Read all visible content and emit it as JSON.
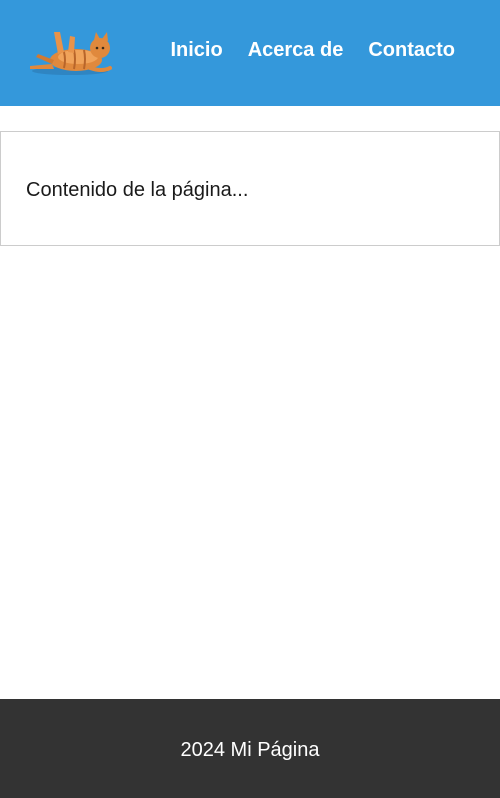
{
  "header": {
    "logo": {
      "icon": "cat-logo-icon"
    },
    "nav": {
      "items": [
        {
          "label": "Inicio"
        },
        {
          "label": "Acerca de"
        },
        {
          "label": "Contacto"
        }
      ]
    }
  },
  "main": {
    "content_text": "Contenido de la página..."
  },
  "footer": {
    "text": "2024 Mi Página"
  },
  "colors": {
    "header_bg": "#3498db",
    "footer_bg": "#333333",
    "content_border": "#cccccc",
    "nav_text": "#ffffff"
  }
}
